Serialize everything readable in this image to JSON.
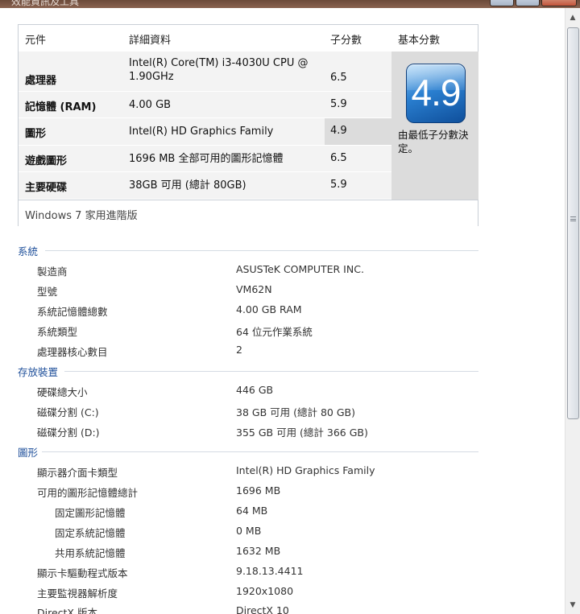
{
  "window": {
    "title": "效能資訊及工具"
  },
  "score_table": {
    "headers": [
      "元件",
      "詳細資料",
      "子分數",
      "基本分數"
    ],
    "rows": [
      {
        "component": "處理器",
        "detail": "Intel(R) Core(TM) i3-4030U CPU @ 1.90GHz",
        "subscore": "6.5"
      },
      {
        "component": "記憶體 (RAM)",
        "detail": "4.00 GB",
        "subscore": "5.9"
      },
      {
        "component": "圖形",
        "detail": "Intel(R) HD Graphics Family",
        "subscore": "4.9",
        "lowest": true
      },
      {
        "component": "遊戲圖形",
        "detail": "1696 MB 全部可用的圖形記憶體",
        "subscore": "6.5"
      },
      {
        "component": "主要硬碟",
        "detail": "38GB 可用 (總計 80GB)",
        "subscore": "5.9"
      }
    ],
    "base_score": "4.9",
    "base_note": "由最低子分數決定。",
    "edition": "Windows 7 家用進階版",
    "badge_color": "#2a7fd0"
  },
  "sections": [
    {
      "title": "系統",
      "items": [
        {
          "label": "製造商",
          "value": "ASUSTeK COMPUTER INC."
        },
        {
          "label": "型號",
          "value": "VM62N"
        },
        {
          "label": "系統記憶體總數",
          "value": "4.00 GB RAM"
        },
        {
          "label": "系統類型",
          "value": "64 位元作業系統"
        },
        {
          "label": "處理器核心數目",
          "value": "2"
        }
      ]
    },
    {
      "title": "存放裝置",
      "items": [
        {
          "label": "硬碟總大小",
          "value": "446 GB"
        },
        {
          "label": "磁碟分割 (C:)",
          "value": "38 GB 可用 (總計 80 GB)"
        },
        {
          "label": "磁碟分割 (D:)",
          "value": "355 GB 可用 (總計 366 GB)"
        }
      ]
    },
    {
      "title": "圖形",
      "items": [
        {
          "label": "顯示器介面卡類型",
          "value": "Intel(R) HD Graphics Family"
        },
        {
          "label": "可用的圖形記憶體總計",
          "value": "1696 MB"
        },
        {
          "label": "固定圖形記憶體",
          "value": "64 MB"
        },
        {
          "label": "固定系統記憶體",
          "value": "0 MB"
        },
        {
          "label": "共用系統記憶體",
          "value": "1632 MB"
        },
        {
          "label": "顯示卡驅動程式版本",
          "value": "9.18.13.4411"
        },
        {
          "label": "主要監視器解析度",
          "value": "1920x1080"
        },
        {
          "label": "DirectX 版本",
          "value": "DirectX 10"
        }
      ]
    }
  ]
}
